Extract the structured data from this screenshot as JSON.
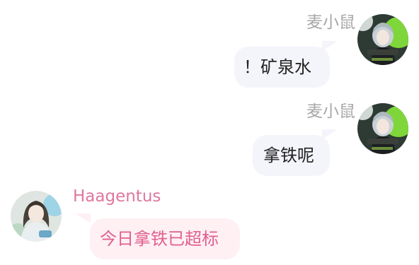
{
  "colors": {
    "self_name": "#a8a8a8",
    "other_name": "#e0779f",
    "outgoing_bubble": "#f4f4fb",
    "incoming_bubble": "#fff0f4",
    "incoming_text": "#e0608f"
  },
  "messages": [
    {
      "sender": "麦小鼠",
      "text": "！矿泉水",
      "direction": "outgoing",
      "avatar_icon": "anime-girl-avatar-icon"
    },
    {
      "sender": "麦小鼠",
      "text": "拿铁呢",
      "direction": "outgoing",
      "avatar_icon": "anime-girl-avatar-icon"
    },
    {
      "sender": "Haagentus",
      "text": "今日拿铁已超标",
      "direction": "incoming",
      "avatar_icon": "anime-girl-avatar-icon"
    }
  ]
}
